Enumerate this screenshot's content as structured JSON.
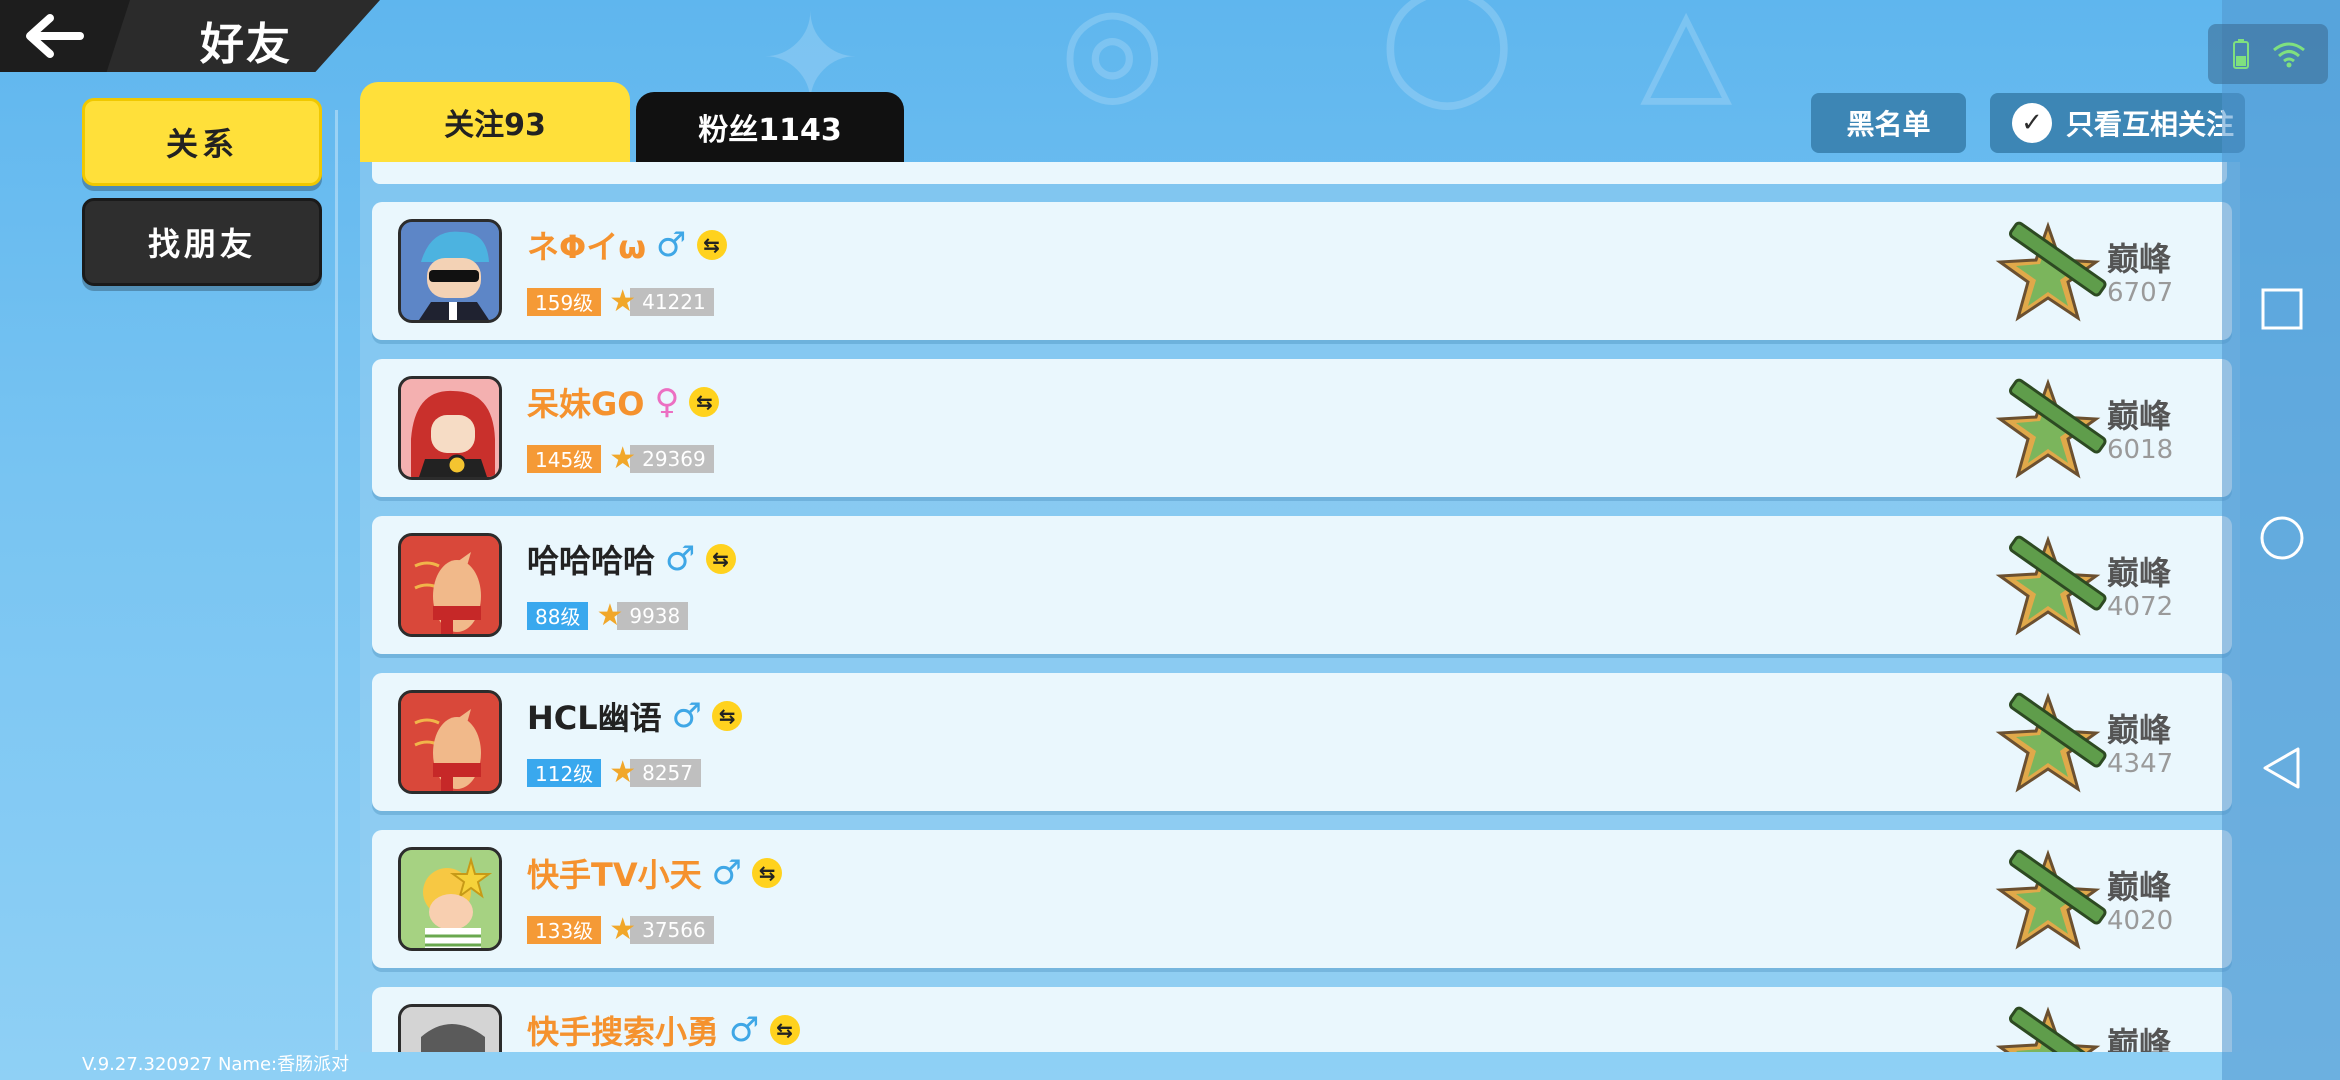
{
  "header": {
    "title": "好友"
  },
  "side_menu": [
    {
      "label": "关系",
      "active": true
    },
    {
      "label": "找朋友",
      "active": false
    }
  ],
  "tabs": [
    {
      "label": "关注93",
      "active": true
    },
    {
      "label": "粉丝1143",
      "active": false
    }
  ],
  "actions": {
    "blacklist": "黑名单",
    "mutual_only": "只看互相关注"
  },
  "friends": [
    {
      "name": "ネΦイω",
      "name_color": "orange",
      "gender": "♂",
      "gender_type": "male",
      "level": "159级",
      "level_color": "orange",
      "score": "41221",
      "rank": "巅峰",
      "rank_score": "6707"
    },
    {
      "name": "呆妹GO",
      "name_color": "orange",
      "gender": "♀",
      "gender_type": "female",
      "level": "145级",
      "level_color": "orange",
      "score": "29369",
      "rank": "巅峰",
      "rank_score": "6018"
    },
    {
      "name": "哈哈哈哈",
      "name_color": "dark",
      "gender": "♂",
      "gender_type": "male",
      "level": "88级",
      "level_color": "blue",
      "score": "9938",
      "rank": "巅峰",
      "rank_score": "4072"
    },
    {
      "name": "HCL幽语",
      "name_color": "dark",
      "gender": "♂",
      "gender_type": "male",
      "level": "112级",
      "level_color": "blue",
      "score": "8257",
      "rank": "巅峰",
      "rank_score": "4347"
    },
    {
      "name": "快手TV小天",
      "name_color": "orange",
      "gender": "♂",
      "gender_type": "male",
      "level": "133级",
      "level_color": "orange",
      "score": "37566",
      "rank": "巅峰",
      "rank_score": "4020"
    },
    {
      "name": "快手搜索小勇",
      "name_color": "orange",
      "gender": "♂",
      "gender_type": "male",
      "level": "",
      "level_color": "orange",
      "score": "",
      "rank": "巅峰",
      "rank_score": ""
    }
  ],
  "footer": {
    "version": "V.9.27.320927 Name:香肠派对"
  },
  "colors": {
    "accent_yellow": "#ffe03a",
    "panel": "#eaf7fd",
    "orange_name": "#f5922e",
    "male_blue": "#3fa7e6",
    "female_pink": "#ec6fc2"
  },
  "icons": [
    "back-arrow-icon",
    "check-icon",
    "male-icon",
    "female-icon",
    "mutual-follow-icon",
    "star-icon",
    "rank-emblem-icon",
    "battery-icon",
    "wifi-icon",
    "square-nav-icon",
    "circle-nav-icon",
    "triangle-back-nav-icon"
  ]
}
